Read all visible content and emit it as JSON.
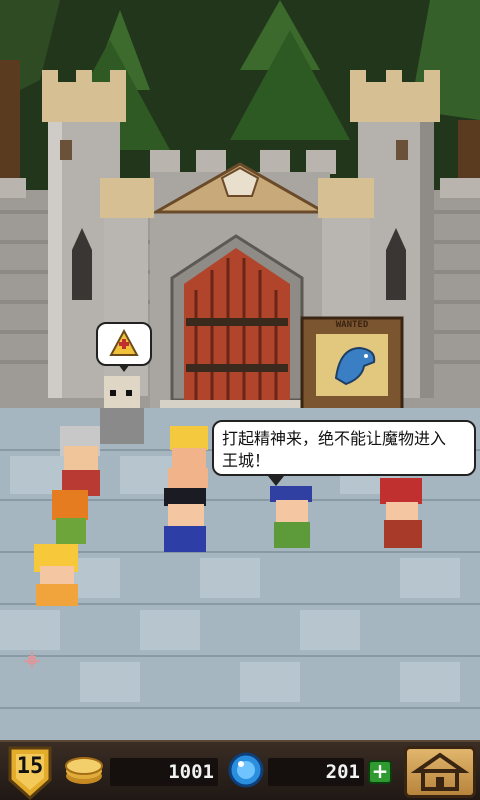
{
  "dialog": {
    "text_line1": "打起精神来，绝不能让魔物进入",
    "text_line2": "王城！"
  },
  "wanted_sign": {
    "title": "WANTED"
  },
  "hud": {
    "level": "15",
    "coins": "1001",
    "gems": "201",
    "plus_label": "+"
  },
  "colors": {
    "sky": "#243a1d",
    "wall": "#a8a6a2",
    "floor": "#9fb3bf",
    "door": "#b0452c",
    "bar": "#2a201a"
  },
  "icons": [
    "quest-icon",
    "coin-icon",
    "gem-icon",
    "home-icon",
    "level-shield-icon",
    "pointer-icon"
  ]
}
